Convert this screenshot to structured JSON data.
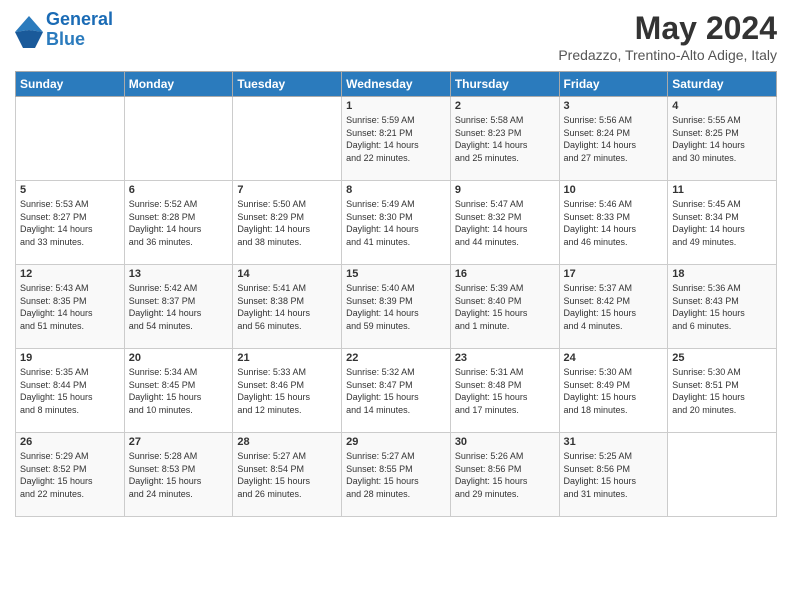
{
  "logo": {
    "line1": "General",
    "line2": "Blue"
  },
  "title": "May 2024",
  "subtitle": "Predazzo, Trentino-Alto Adige, Italy",
  "days_header": [
    "Sunday",
    "Monday",
    "Tuesday",
    "Wednesday",
    "Thursday",
    "Friday",
    "Saturday"
  ],
  "weeks": [
    [
      {
        "day": "",
        "info": ""
      },
      {
        "day": "",
        "info": ""
      },
      {
        "day": "",
        "info": ""
      },
      {
        "day": "1",
        "info": "Sunrise: 5:59 AM\nSunset: 8:21 PM\nDaylight: 14 hours\nand 22 minutes."
      },
      {
        "day": "2",
        "info": "Sunrise: 5:58 AM\nSunset: 8:23 PM\nDaylight: 14 hours\nand 25 minutes."
      },
      {
        "day": "3",
        "info": "Sunrise: 5:56 AM\nSunset: 8:24 PM\nDaylight: 14 hours\nand 27 minutes."
      },
      {
        "day": "4",
        "info": "Sunrise: 5:55 AM\nSunset: 8:25 PM\nDaylight: 14 hours\nand 30 minutes."
      }
    ],
    [
      {
        "day": "5",
        "info": "Sunrise: 5:53 AM\nSunset: 8:27 PM\nDaylight: 14 hours\nand 33 minutes."
      },
      {
        "day": "6",
        "info": "Sunrise: 5:52 AM\nSunset: 8:28 PM\nDaylight: 14 hours\nand 36 minutes."
      },
      {
        "day": "7",
        "info": "Sunrise: 5:50 AM\nSunset: 8:29 PM\nDaylight: 14 hours\nand 38 minutes."
      },
      {
        "day": "8",
        "info": "Sunrise: 5:49 AM\nSunset: 8:30 PM\nDaylight: 14 hours\nand 41 minutes."
      },
      {
        "day": "9",
        "info": "Sunrise: 5:47 AM\nSunset: 8:32 PM\nDaylight: 14 hours\nand 44 minutes."
      },
      {
        "day": "10",
        "info": "Sunrise: 5:46 AM\nSunset: 8:33 PM\nDaylight: 14 hours\nand 46 minutes."
      },
      {
        "day": "11",
        "info": "Sunrise: 5:45 AM\nSunset: 8:34 PM\nDaylight: 14 hours\nand 49 minutes."
      }
    ],
    [
      {
        "day": "12",
        "info": "Sunrise: 5:43 AM\nSunset: 8:35 PM\nDaylight: 14 hours\nand 51 minutes."
      },
      {
        "day": "13",
        "info": "Sunrise: 5:42 AM\nSunset: 8:37 PM\nDaylight: 14 hours\nand 54 minutes."
      },
      {
        "day": "14",
        "info": "Sunrise: 5:41 AM\nSunset: 8:38 PM\nDaylight: 14 hours\nand 56 minutes."
      },
      {
        "day": "15",
        "info": "Sunrise: 5:40 AM\nSunset: 8:39 PM\nDaylight: 14 hours\nand 59 minutes."
      },
      {
        "day": "16",
        "info": "Sunrise: 5:39 AM\nSunset: 8:40 PM\nDaylight: 15 hours\nand 1 minute."
      },
      {
        "day": "17",
        "info": "Sunrise: 5:37 AM\nSunset: 8:42 PM\nDaylight: 15 hours\nand 4 minutes."
      },
      {
        "day": "18",
        "info": "Sunrise: 5:36 AM\nSunset: 8:43 PM\nDaylight: 15 hours\nand 6 minutes."
      }
    ],
    [
      {
        "day": "19",
        "info": "Sunrise: 5:35 AM\nSunset: 8:44 PM\nDaylight: 15 hours\nand 8 minutes."
      },
      {
        "day": "20",
        "info": "Sunrise: 5:34 AM\nSunset: 8:45 PM\nDaylight: 15 hours\nand 10 minutes."
      },
      {
        "day": "21",
        "info": "Sunrise: 5:33 AM\nSunset: 8:46 PM\nDaylight: 15 hours\nand 12 minutes."
      },
      {
        "day": "22",
        "info": "Sunrise: 5:32 AM\nSunset: 8:47 PM\nDaylight: 15 hours\nand 14 minutes."
      },
      {
        "day": "23",
        "info": "Sunrise: 5:31 AM\nSunset: 8:48 PM\nDaylight: 15 hours\nand 17 minutes."
      },
      {
        "day": "24",
        "info": "Sunrise: 5:30 AM\nSunset: 8:49 PM\nDaylight: 15 hours\nand 18 minutes."
      },
      {
        "day": "25",
        "info": "Sunrise: 5:30 AM\nSunset: 8:51 PM\nDaylight: 15 hours\nand 20 minutes."
      }
    ],
    [
      {
        "day": "26",
        "info": "Sunrise: 5:29 AM\nSunset: 8:52 PM\nDaylight: 15 hours\nand 22 minutes."
      },
      {
        "day": "27",
        "info": "Sunrise: 5:28 AM\nSunset: 8:53 PM\nDaylight: 15 hours\nand 24 minutes."
      },
      {
        "day": "28",
        "info": "Sunrise: 5:27 AM\nSunset: 8:54 PM\nDaylight: 15 hours\nand 26 minutes."
      },
      {
        "day": "29",
        "info": "Sunrise: 5:27 AM\nSunset: 8:55 PM\nDaylight: 15 hours\nand 28 minutes."
      },
      {
        "day": "30",
        "info": "Sunrise: 5:26 AM\nSunset: 8:56 PM\nDaylight: 15 hours\nand 29 minutes."
      },
      {
        "day": "31",
        "info": "Sunrise: 5:25 AM\nSunset: 8:56 PM\nDaylight: 15 hours\nand 31 minutes."
      },
      {
        "day": "",
        "info": ""
      }
    ]
  ]
}
